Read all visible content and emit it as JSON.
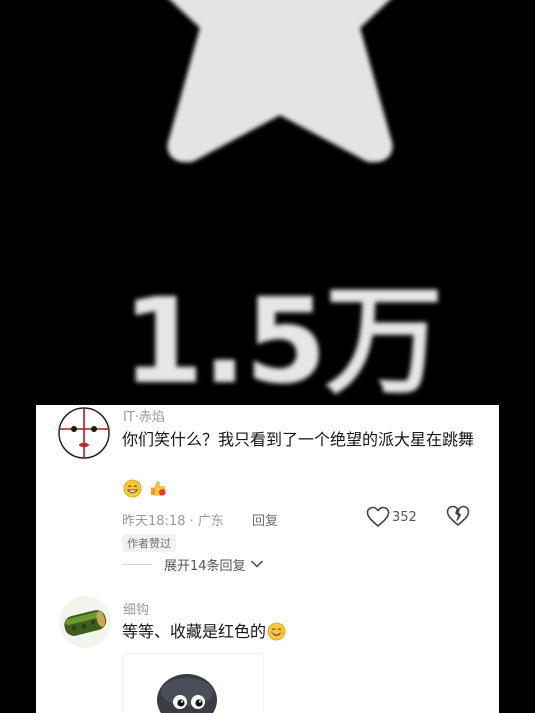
{
  "background": {
    "icon": "star-icon",
    "count_text": "1.5万"
  },
  "comments": [
    {
      "username": "IT·赤焰",
      "text": "你们笑什么？我只看到了一个绝望的派大星在跳舞",
      "emojis": [
        "grin-sweat-emoji",
        "thumbs-up-emoji"
      ],
      "time_location": "昨天18:18 · 广东",
      "reply_label": "回复",
      "like_count": "352",
      "badge": "作者赞过",
      "expand_label": "展开14条回复"
    },
    {
      "username": "细钩",
      "text": "等等、收藏是红色的",
      "emoji": "smile-emoji",
      "image": "sticker-image"
    }
  ],
  "colors": {
    "background": "#000000",
    "sheet": "#ffffff",
    "text_primary": "#161616",
    "text_secondary": "#9a9a9a"
  }
}
